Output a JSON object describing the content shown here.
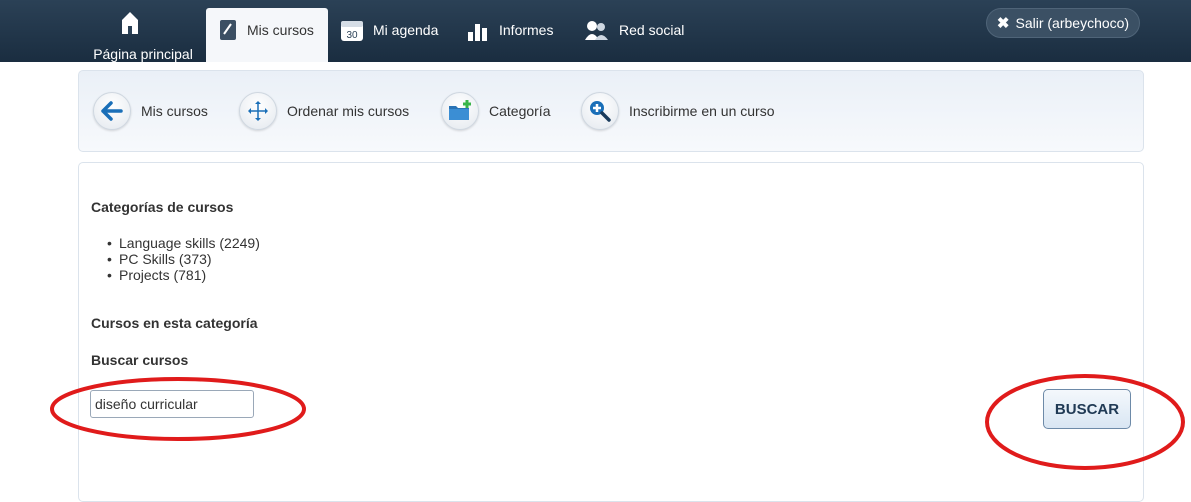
{
  "nav": {
    "home_label": "Página principal",
    "tabs": [
      {
        "label": "Mis cursos",
        "icon": "book-icon",
        "active": true
      },
      {
        "label": "Mi agenda",
        "icon": "calendar-icon",
        "calendar_day": "30"
      },
      {
        "label": "Informes",
        "icon": "bar-chart-icon"
      },
      {
        "label": "Red social",
        "icon": "people-icon"
      }
    ],
    "logout_label": "Salir (arbeychoco)"
  },
  "actions": [
    {
      "label": "Mis cursos",
      "icon": "arrow-left-icon"
    },
    {
      "label": "Ordenar mis cursos",
      "icon": "move-icon"
    },
    {
      "label": "Categoría",
      "icon": "folder-add-icon"
    },
    {
      "label": "Inscribirme en un curso",
      "icon": "search-add-icon"
    }
  ],
  "content": {
    "categories_title": "Categorías de cursos",
    "categories": [
      "Language skills (2249)",
      "PC Skills (373)",
      "Projects (781)"
    ],
    "in_category_title": "Cursos en esta categoría",
    "search_title": "Buscar cursos",
    "search_value": "diseño curricular",
    "search_button": "BUSCAR"
  },
  "colors": {
    "nav_bg": "#1f3348",
    "annotation_red": "#e01b1b",
    "accent_blue": "#1a6fb8"
  }
}
